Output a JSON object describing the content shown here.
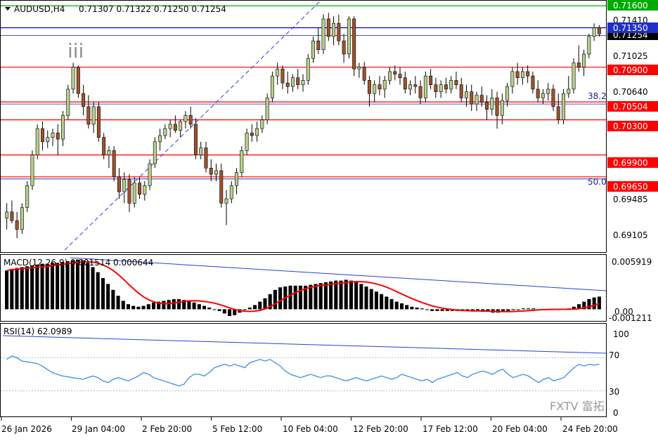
{
  "header": {
    "symbol": "AUDUSD,H4",
    "ohlc": "0.71307 0.71322 0.71250 0.71254"
  },
  "wave_label": "iii",
  "price_axis": {
    "ticks": [
      "0.71410",
      "0.71025",
      "0.70640",
      "0.69485",
      "0.69105"
    ],
    "current_price": "0.71254"
  },
  "levels": [
    {
      "label": "0.71600",
      "value": 0.716,
      "line_color": "#00aa00",
      "tag_bg": "#00aa00"
    },
    {
      "label": "0.71350",
      "value": 0.7135,
      "line_color": "#0000cc",
      "tag_bg": "#1f2fcc"
    },
    {
      "label": "0.70900",
      "value": 0.709,
      "line_color": "#ff0000",
      "tag_bg": "#ff0000"
    },
    {
      "label": "0.70504",
      "value": 0.70504,
      "line_color": "#ff0000",
      "tag_bg": "#ff0000"
    },
    {
      "label": "0.70300",
      "value": 0.703,
      "line_color": "#ff0000",
      "tag_bg": "#ff0000"
    },
    {
      "label": "0.69900",
      "value": 0.699,
      "line_color": "#ff0000",
      "tag_bg": "#ff0000"
    },
    {
      "label": "0.69650",
      "value": 0.6965,
      "line_color": "#ff0000",
      "tag_bg": "#ff0000"
    }
  ],
  "fib_labels": [
    {
      "label": "38.2",
      "value": 0.70504
    },
    {
      "label": "50.0",
      "value": 0.6965
    }
  ],
  "macd": {
    "label": "MACD(12,26,9) 0.001514 0.000644",
    "ticks": [
      "0.005919",
      "0.00",
      "-0.001211"
    ]
  },
  "rsi": {
    "label": "RSI(14) 62.0989",
    "ticks": [
      "100",
      "70",
      "30",
      "0"
    ]
  },
  "time_axis": {
    "labels": [
      "26 Jan 2026",
      "29 Jan 04:00",
      "2 Feb 20:00",
      "5 Feb 12:00",
      "10 Feb 04:00",
      "12 Feb 20:00",
      "17 Feb 12:00",
      "20 Feb 04:00",
      "24 Feb 20:00"
    ]
  },
  "watermark": "FXTV 富拓",
  "colors": {
    "bull": "#b5cf8a",
    "bear": "#a0522d",
    "macd_signal": "#ff0000",
    "rsi_line": "#3a8ee6",
    "trendline": "#2a3fd6"
  },
  "chart_data": {
    "type": "candlestick",
    "symbol": "AUDUSD",
    "timeframe": "H4",
    "price_range": [
      0.688,
      0.7165
    ],
    "candles": [
      [
        0.6918,
        0.6935,
        0.6905,
        0.6925
      ],
      [
        0.6925,
        0.6938,
        0.6912,
        0.6915
      ],
      [
        0.6915,
        0.6925,
        0.6895,
        0.6905
      ],
      [
        0.6905,
        0.6935,
        0.69,
        0.693
      ],
      [
        0.693,
        0.696,
        0.6925,
        0.6955
      ],
      [
        0.6955,
        0.6995,
        0.695,
        0.699
      ],
      [
        0.699,
        0.7025,
        0.6985,
        0.702
      ],
      [
        0.702,
        0.7028,
        0.6995,
        0.7005
      ],
      [
        0.7005,
        0.7018,
        0.6998,
        0.701
      ],
      [
        0.701,
        0.702,
        0.7,
        0.7015
      ],
      [
        0.7015,
        0.7025,
        0.699,
        0.7008
      ],
      [
        0.7008,
        0.704,
        0.7,
        0.7035
      ],
      [
        0.7035,
        0.707,
        0.703,
        0.7065
      ],
      [
        0.7065,
        0.7095,
        0.706,
        0.709
      ],
      [
        0.709,
        0.7092,
        0.7055,
        0.706
      ],
      [
        0.706,
        0.707,
        0.7035,
        0.7045
      ],
      [
        0.7045,
        0.7058,
        0.702,
        0.7025
      ],
      [
        0.7025,
        0.705,
        0.7015,
        0.7045
      ],
      [
        0.7045,
        0.705,
        0.7005,
        0.701
      ],
      [
        0.701,
        0.7015,
        0.6985,
        0.699
      ],
      [
        0.699,
        0.7,
        0.6975,
        0.6995
      ],
      [
        0.6995,
        0.7,
        0.696,
        0.6965
      ],
      [
        0.6965,
        0.6975,
        0.694,
        0.6948
      ],
      [
        0.6948,
        0.697,
        0.6935,
        0.6962
      ],
      [
        0.6962,
        0.6968,
        0.6925,
        0.6935
      ],
      [
        0.6935,
        0.6965,
        0.693,
        0.6958
      ],
      [
        0.6958,
        0.6965,
        0.694,
        0.6945
      ],
      [
        0.6945,
        0.696,
        0.6938,
        0.6955
      ],
      [
        0.6955,
        0.6985,
        0.695,
        0.698
      ],
      [
        0.698,
        0.701,
        0.6975,
        0.7005
      ],
      [
        0.7005,
        0.702,
        0.6995,
        0.7012
      ],
      [
        0.7012,
        0.7025,
        0.7008,
        0.702
      ],
      [
        0.702,
        0.703,
        0.701,
        0.7025
      ],
      [
        0.7025,
        0.7035,
        0.7015,
        0.7018
      ],
      [
        0.7018,
        0.703,
        0.701,
        0.7028
      ],
      [
        0.7028,
        0.704,
        0.702,
        0.7035
      ],
      [
        0.7035,
        0.7045,
        0.702,
        0.7025
      ],
      [
        0.7025,
        0.7032,
        0.6985,
        0.699
      ],
      [
        0.699,
        0.7005,
        0.6985,
        0.6998
      ],
      [
        0.6998,
        0.7005,
        0.697,
        0.6975
      ],
      [
        0.6975,
        0.6985,
        0.696,
        0.6968
      ],
      [
        0.6968,
        0.698,
        0.696,
        0.6972
      ],
      [
        0.6972,
        0.698,
        0.693,
        0.6935
      ],
      [
        0.6935,
        0.695,
        0.691,
        0.694
      ],
      [
        0.694,
        0.696,
        0.6935,
        0.6955
      ],
      [
        0.6955,
        0.6975,
        0.6945,
        0.697
      ],
      [
        0.697,
        0.7,
        0.6965,
        0.6995
      ],
      [
        0.6995,
        0.702,
        0.699,
        0.7015
      ],
      [
        0.7015,
        0.7025,
        0.7005,
        0.7012
      ],
      [
        0.7012,
        0.7028,
        0.7005,
        0.702
      ],
      [
        0.702,
        0.7035,
        0.7015,
        0.703
      ],
      [
        0.703,
        0.706,
        0.7025,
        0.7055
      ],
      [
        0.7055,
        0.7085,
        0.705,
        0.708
      ],
      [
        0.708,
        0.7095,
        0.707,
        0.7088
      ],
      [
        0.7088,
        0.7092,
        0.7065,
        0.7072
      ],
      [
        0.7072,
        0.7085,
        0.706,
        0.7068
      ],
      [
        0.7068,
        0.7082,
        0.7062,
        0.7078
      ],
      [
        0.7078,
        0.7088,
        0.7065,
        0.707
      ],
      [
        0.707,
        0.7082,
        0.7062,
        0.7075
      ],
      [
        0.7075,
        0.7105,
        0.707,
        0.71
      ],
      [
        0.71,
        0.7125,
        0.7095,
        0.712
      ],
      [
        0.712,
        0.7135,
        0.7105,
        0.711
      ],
      [
        0.711,
        0.715,
        0.7105,
        0.7145
      ],
      [
        0.7145,
        0.7152,
        0.712,
        0.7125
      ],
      [
        0.7125,
        0.7148,
        0.7115,
        0.714
      ],
      [
        0.714,
        0.715,
        0.7115,
        0.712
      ],
      [
        0.712,
        0.7128,
        0.7095,
        0.7105
      ],
      [
        0.7105,
        0.7148,
        0.71,
        0.7145
      ],
      [
        0.7145,
        0.7148,
        0.708,
        0.7088
      ],
      [
        0.7088,
        0.7095,
        0.7078,
        0.709
      ],
      [
        0.709,
        0.7096,
        0.707,
        0.7075
      ],
      [
        0.7075,
        0.708,
        0.7045,
        0.706
      ],
      [
        0.706,
        0.7075,
        0.705,
        0.707
      ],
      [
        0.707,
        0.708,
        0.7058,
        0.7065
      ],
      [
        0.7065,
        0.708,
        0.7055,
        0.7075
      ],
      [
        0.7075,
        0.709,
        0.707,
        0.7085
      ],
      [
        0.7085,
        0.7092,
        0.7075,
        0.7082
      ],
      [
        0.7082,
        0.709,
        0.707,
        0.7078
      ],
      [
        0.7078,
        0.7085,
        0.706,
        0.7065
      ],
      [
        0.7065,
        0.7075,
        0.7058,
        0.707
      ],
      [
        0.707,
        0.708,
        0.706,
        0.7068
      ],
      [
        0.7068,
        0.7075,
        0.7048,
        0.7055
      ],
      [
        0.7055,
        0.7085,
        0.705,
        0.708
      ],
      [
        0.708,
        0.7088,
        0.7065,
        0.707
      ],
      [
        0.707,
        0.7078,
        0.7055,
        0.7062
      ],
      [
        0.7062,
        0.7075,
        0.7055,
        0.707
      ],
      [
        0.707,
        0.7078,
        0.706,
        0.7065
      ],
      [
        0.7065,
        0.708,
        0.706,
        0.7075
      ],
      [
        0.7075,
        0.7085,
        0.7065,
        0.707
      ],
      [
        0.707,
        0.7078,
        0.705,
        0.7055
      ],
      [
        0.7055,
        0.707,
        0.7045,
        0.7062
      ],
      [
        0.7062,
        0.707,
        0.704,
        0.7048
      ],
      [
        0.7048,
        0.7062,
        0.704,
        0.7058
      ],
      [
        0.7058,
        0.7068,
        0.7045,
        0.705
      ],
      [
        0.705,
        0.7058,
        0.703,
        0.7042
      ],
      [
        0.7042,
        0.7065,
        0.7035,
        0.7055
      ],
      [
        0.7055,
        0.7062,
        0.702,
        0.7035
      ],
      [
        0.7035,
        0.706,
        0.7025,
        0.7052
      ],
      [
        0.7052,
        0.7072,
        0.7045,
        0.7068
      ],
      [
        0.7068,
        0.709,
        0.706,
        0.7085
      ],
      [
        0.7085,
        0.7095,
        0.707,
        0.7078
      ],
      [
        0.7078,
        0.709,
        0.707,
        0.7085
      ],
      [
        0.7085,
        0.7092,
        0.7072,
        0.708
      ],
      [
        0.708,
        0.7085,
        0.706,
        0.7065
      ],
      [
        0.7065,
        0.7075,
        0.705,
        0.7055
      ],
      [
        0.7055,
        0.7065,
        0.7048,
        0.706
      ],
      [
        0.706,
        0.7072,
        0.7052,
        0.7065
      ],
      [
        0.7065,
        0.707,
        0.704,
        0.7045
      ],
      [
        0.7045,
        0.706,
        0.7025,
        0.703
      ],
      [
        0.703,
        0.7065,
        0.7025,
        0.706
      ],
      [
        0.706,
        0.708,
        0.7055,
        0.7065
      ],
      [
        0.7065,
        0.71,
        0.706,
        0.7095
      ],
      [
        0.7095,
        0.7115,
        0.7085,
        0.709
      ],
      [
        0.709,
        0.711,
        0.708,
        0.7105
      ],
      [
        0.7105,
        0.7128,
        0.71,
        0.7125
      ],
      [
        0.7125,
        0.714,
        0.712,
        0.7135
      ],
      [
        0.7135,
        0.7138,
        0.7125,
        0.7128
      ]
    ],
    "macd_values": [
      0.0046,
      0.0048,
      0.0049,
      0.005,
      0.0051,
      0.0052,
      0.0053,
      0.0054,
      0.0054,
      0.0055,
      0.0055,
      0.0056,
      0.0057,
      0.0058,
      0.0059,
      0.0058,
      0.0055,
      0.005,
      0.0044,
      0.0037,
      0.003,
      0.0023,
      0.0016,
      0.001,
      0.0006,
      0.0004,
      0.0003,
      0.0004,
      0.0006,
      0.0008,
      0.0009,
      0.001,
      0.0011,
      0.0012,
      0.0012,
      0.0011,
      0.001,
      0.0008,
      0.0006,
      0.0004,
      0.0002,
      0.0,
      -0.0002,
      -0.0005,
      -0.0008,
      -0.0007,
      -0.0004,
      -0.0001,
      0.0002,
      0.0005,
      0.0009,
      0.0013,
      0.0018,
      0.0023,
      0.0026,
      0.0027,
      0.0028,
      0.0028,
      0.0028,
      0.0028,
      0.0029,
      0.003,
      0.0031,
      0.0032,
      0.0033,
      0.0034,
      0.0034,
      0.0035,
      0.0034,
      0.0032,
      0.003,
      0.0027,
      0.0024,
      0.0021,
      0.0018,
      0.0015,
      0.0012,
      0.0009,
      0.0007,
      0.0005,
      0.0003,
      0.0002,
      0.0001,
      0.0,
      -0.0002,
      -0.0002,
      -0.0002,
      -0.0002,
      -0.0002,
      -0.0002,
      -0.0002,
      -0.0002,
      -0.0002,
      -0.0002,
      -0.0003,
      -0.0003,
      -0.0004,
      -0.0004,
      -0.0003,
      -0.0002,
      -0.0001,
      0.0,
      0.0001,
      0.0001,
      0.0001,
      0.0,
      -0.0001,
      -0.0001,
      -0.0001,
      -0.0001,
      0.0,
      0.0001,
      0.0003,
      0.0006,
      0.0009,
      0.0012,
      0.0014,
      0.0015
    ],
    "rsi_values": [
      68,
      72,
      70,
      66,
      65,
      64,
      63,
      60,
      56,
      52,
      50,
      48,
      47,
      46,
      45,
      44,
      46,
      48,
      46,
      42,
      40,
      44,
      46,
      44,
      42,
      45,
      48,
      52,
      50,
      46,
      44,
      42,
      40,
      38,
      36,
      38,
      46,
      50,
      50,
      48,
      52,
      58,
      60,
      62,
      60,
      62,
      60,
      58,
      64,
      66,
      68,
      66,
      68,
      64,
      60,
      54,
      50,
      48,
      46,
      48,
      50,
      48,
      46,
      48,
      48,
      46,
      44,
      42,
      44,
      46,
      44,
      42,
      44,
      46,
      48,
      46,
      44,
      46,
      50,
      48,
      46,
      44,
      42,
      44,
      40,
      44,
      46,
      48,
      50,
      52,
      48,
      46,
      50,
      52,
      54,
      52,
      50,
      54,
      56,
      50,
      46,
      48,
      50,
      48,
      44,
      40,
      44,
      46,
      42,
      44,
      46,
      52,
      58,
      62,
      60,
      62,
      61,
      62
    ],
    "rsi_range": [
      0,
      100
    ],
    "rsi_levels": [
      30,
      70
    ]
  }
}
